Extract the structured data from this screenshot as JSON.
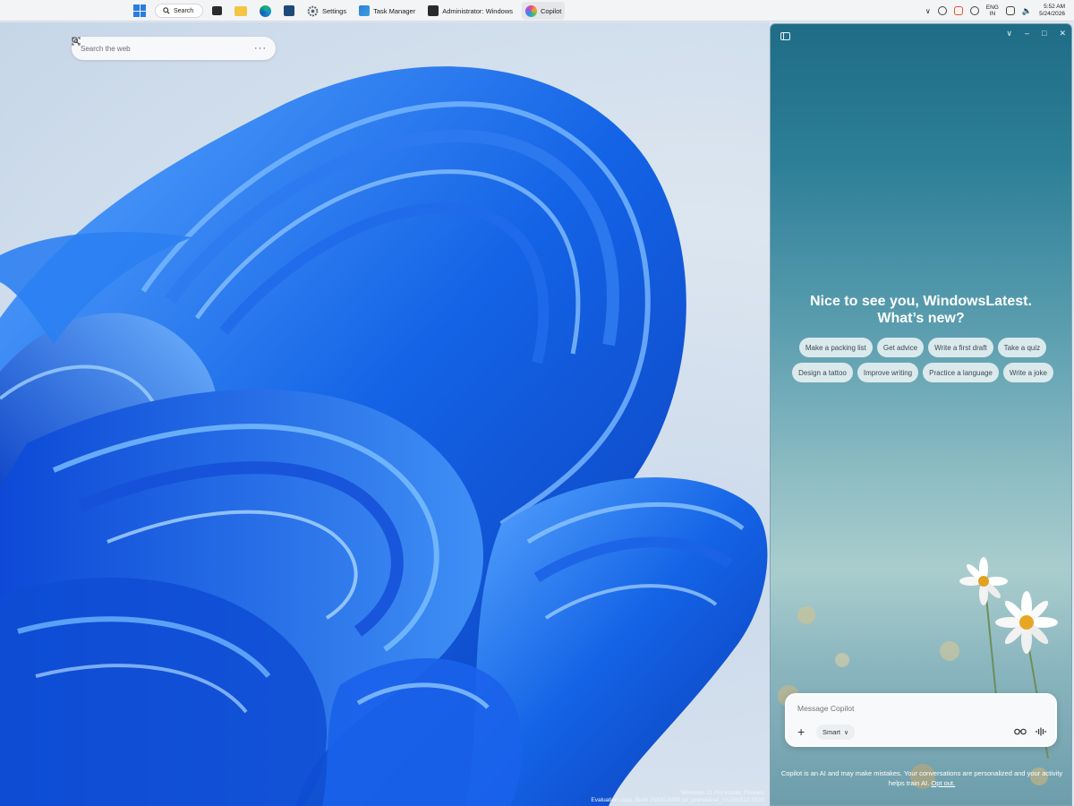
{
  "taskbar": {
    "search_label": "Search",
    "apps": [
      {
        "label": "Settings",
        "icon": "gear-icon"
      },
      {
        "label": "Task Manager",
        "icon": "task-manager-icon"
      },
      {
        "label": "Administrator: Windows",
        "icon": "terminal-icon"
      },
      {
        "label": "Copilot",
        "icon": "copilot-icon"
      }
    ],
    "tray": {
      "language_top": "ENG",
      "language_bottom": "IN",
      "time": "5:52 AM",
      "date": "5/24/2026"
    }
  },
  "desktop": {
    "search_placeholder": "Search the web",
    "watermark_line1": "Windows 11 Pro Insider Preview",
    "watermark_line2": "Evaluation copy. Build 26300.8493.ge_prerelease_im.260513-1823"
  },
  "copilot": {
    "greeting": "Nice to see you, WindowsLatest. What’s new?",
    "suggestions": [
      "Make a packing list",
      "Get advice",
      "Write a first draft",
      "Take a quiz",
      "Design a tattoo",
      "Improve writing",
      "Practice a language",
      "Write a joke"
    ],
    "message_placeholder": "Message Copilot",
    "mode_label": "Smart",
    "disclaimer": "Copilot is an AI and may make mistakes. Your conversations are personalized and your activity helps train AI.",
    "opt_out_label": "Opt out."
  },
  "colors": {
    "accent_blue": "#2a7de1",
    "copilot_top": "#1f6c86",
    "copilot_mid": "#8ebdc4"
  }
}
